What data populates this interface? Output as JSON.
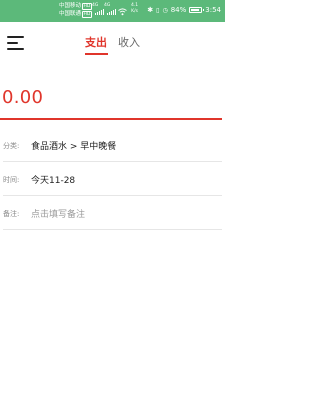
{
  "status_bar": {
    "carrier1": "中国移动",
    "carrier1_badge": "HD",
    "carrier2": "中国联通",
    "carrier2_badge": "HD",
    "network1": "4G",
    "network2": "4G",
    "speed_value": "4.1",
    "speed_unit": "K/s",
    "battery_percent": "84%",
    "battery_level": 0.84,
    "time": "3:54",
    "icons": [
      "signal-icon",
      "wifi-icon",
      "bluetooth-icon",
      "vibrate-icon",
      "alarm-icon",
      "battery-icon"
    ]
  },
  "toolbar": {
    "menu_icon": "menu-icon",
    "tabs": [
      {
        "label": "支出",
        "active": true
      },
      {
        "label": "收入",
        "active": false
      }
    ]
  },
  "amount": {
    "value": "0.00",
    "color": "#e0352b"
  },
  "form": {
    "category": {
      "label": "分类:",
      "value": "食品酒水  >  早中晚餐"
    },
    "date": {
      "label": "时间:",
      "value": "今天11-28"
    },
    "note": {
      "label": "备注:",
      "placeholder": "点击填写备注"
    }
  },
  "colors": {
    "accent": "#e0352b",
    "status_bar": "#5cb97a"
  }
}
